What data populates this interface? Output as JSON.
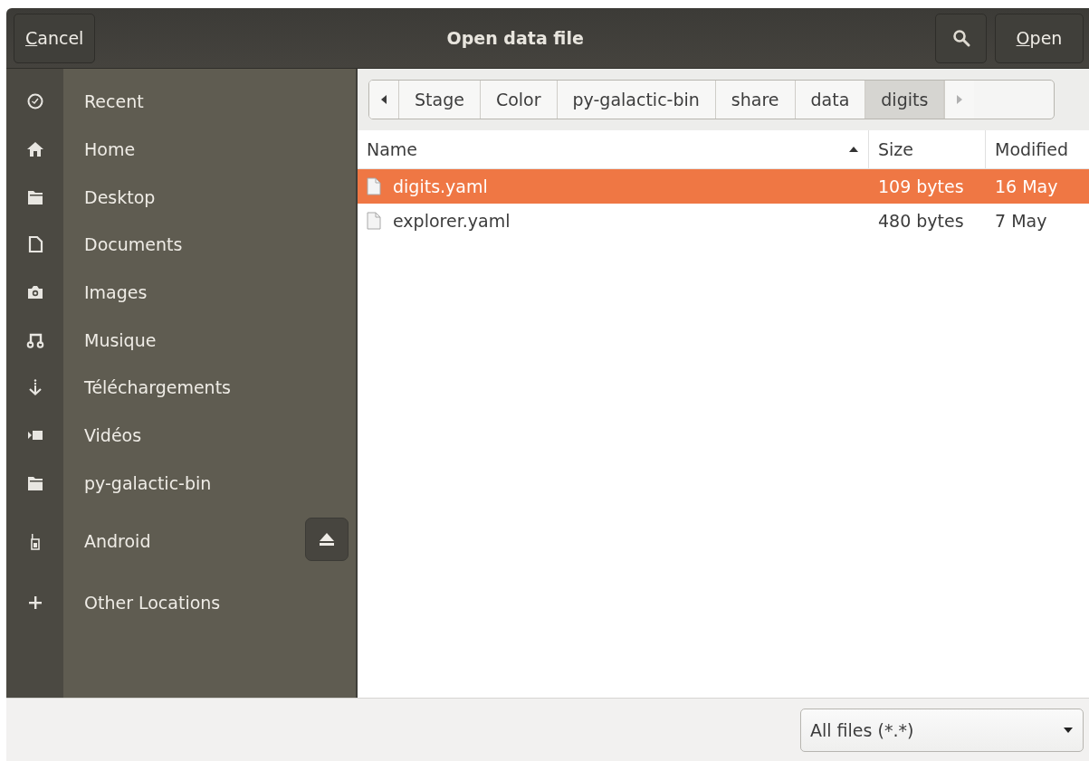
{
  "header": {
    "cancel": {
      "label": "Cancel",
      "underline_first": true
    },
    "title": "Open data file",
    "open": {
      "label": "Open",
      "underline_first": true
    }
  },
  "sidebar": {
    "items": [
      {
        "label": "Recent",
        "kind": "place",
        "selected": false
      },
      {
        "label": "Home",
        "kind": "place",
        "selected": false
      },
      {
        "label": "Desktop",
        "kind": "place",
        "selected": false
      },
      {
        "label": "Documents",
        "kind": "place",
        "selected": false
      },
      {
        "label": "Images",
        "kind": "place",
        "selected": false
      },
      {
        "label": "Musique",
        "kind": "place",
        "selected": false
      },
      {
        "label": "Téléchargements",
        "kind": "place",
        "selected": false
      },
      {
        "label": "Vidéos",
        "kind": "place",
        "selected": false
      },
      {
        "label": "py-galactic-bin",
        "kind": "place",
        "selected": false
      },
      {
        "label": "Android",
        "kind": "device",
        "selected": false
      },
      {
        "label": "Other Locations",
        "kind": "action",
        "selected": false
      }
    ]
  },
  "path_bar": {
    "segments": [
      {
        "label": "Stage",
        "selected": false
      },
      {
        "label": "Color",
        "selected": false
      },
      {
        "label": "py-galactic-bin",
        "selected": false
      },
      {
        "label": "share",
        "selected": false
      },
      {
        "label": "data",
        "selected": false
      },
      {
        "label": "digits",
        "selected": true
      }
    ]
  },
  "table": {
    "columns": [
      {
        "label": "Name",
        "sorted": true
      },
      {
        "label": "Size",
        "sorted": false
      },
      {
        "label": "Modified",
        "sorted": false
      }
    ],
    "rows": [
      {
        "name": "digits.yaml",
        "size": "109 bytes",
        "modified": "16 May",
        "selected": true
      },
      {
        "name": "explorer.yaml",
        "size": "480 bytes",
        "modified": "7 May",
        "selected": false
      }
    ]
  },
  "filter": {
    "value": "All files (*.*)"
  }
}
